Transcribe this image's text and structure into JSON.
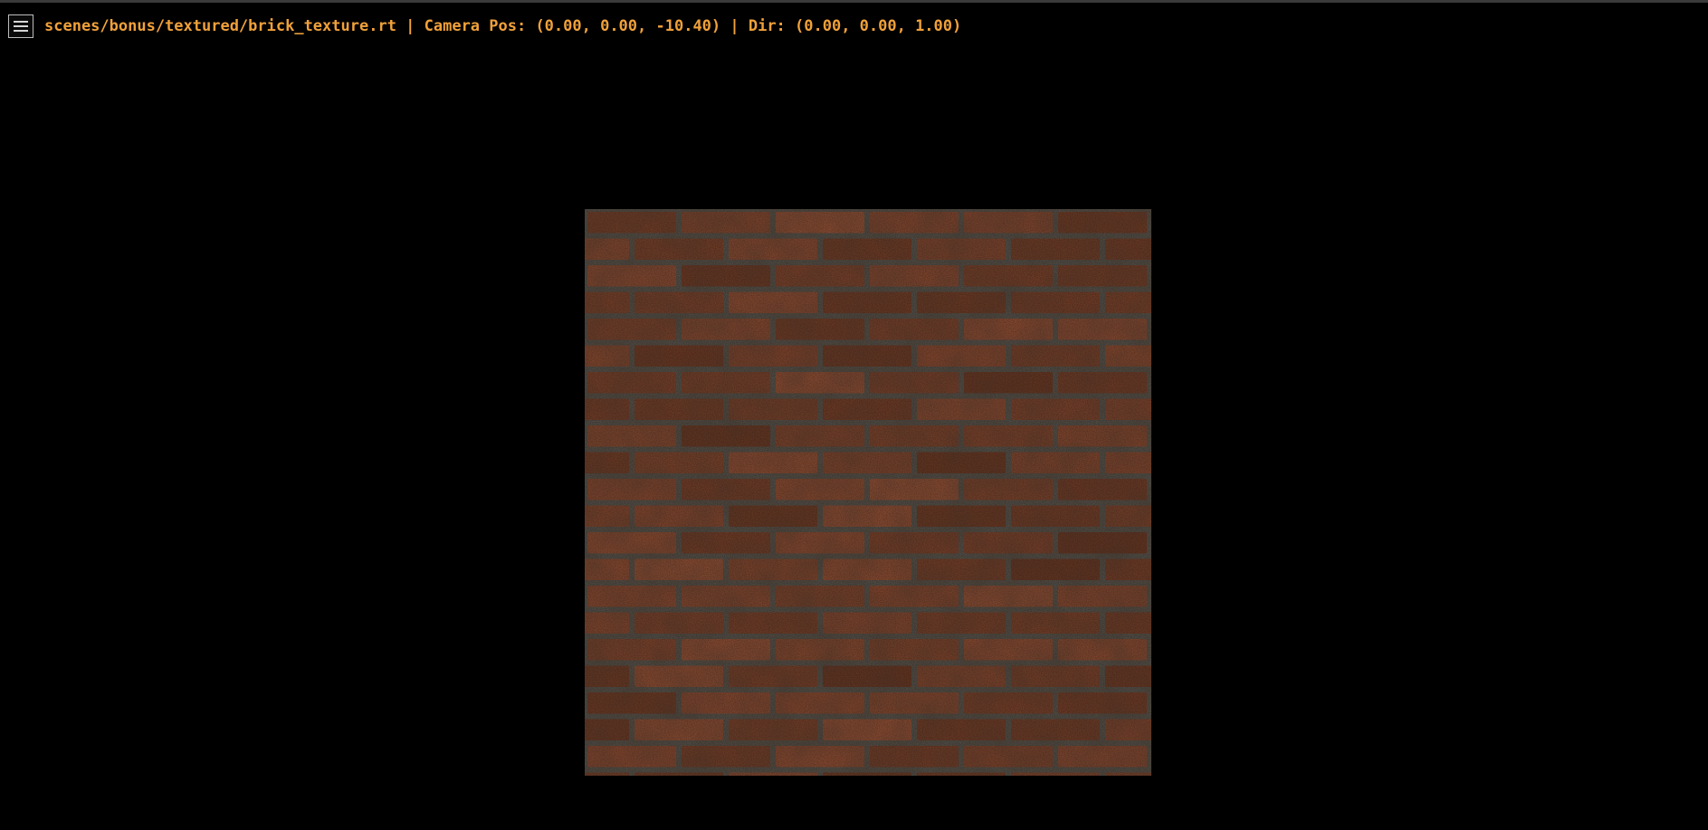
{
  "window": {
    "status_text": "scenes/bonus/textured/brick_texture.rt | Camera Pos: (0.00, 0.00, -10.40) | Dir: (0.00, 0.00, 1.00)",
    "status_color": "#f0a13a",
    "background_color": "#000000"
  },
  "menu_button": {
    "icon": "hamburger-menu-icon"
  },
  "render": {
    "object": "textured plane",
    "texture": "brick",
    "brick_color": "#8a4a30",
    "mortar_color": "#5e5a52"
  }
}
